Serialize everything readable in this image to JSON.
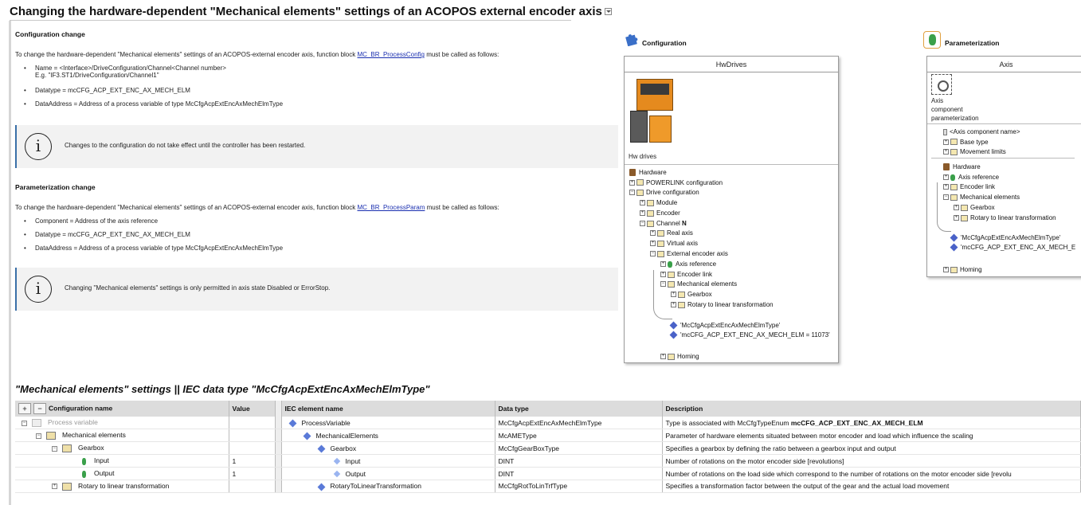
{
  "page": {
    "title": "Changing the hardware-dependent \"Mechanical elements\" settings of an ACOPOS external encoder axis"
  },
  "config_change": {
    "heading": "Configuration change",
    "intro_before": "To change the hardware-dependent \"Mechanical elements\" settings of an ACOPOS-external encoder axis, function block ",
    "link": "MC_BR_ProcessConfig",
    "intro_after": " must be called as follows:",
    "bullets": [
      "Name = <Interface>/DriveConfiguration/Channel<Channel number>",
      "Datatype = mcCFG_ACP_EXT_ENC_AX_MECH_ELM",
      "DataAddress = Address of a process variable of type McCfgAcpExtEncAxMechElmType"
    ],
    "bullet_example": "E.g. \"IF3.ST1/DriveConfiguration/Channel1\"",
    "note": "Changes to the configuration do not take effect until the controller has been restarted."
  },
  "param_change": {
    "heading": "Parameterization change",
    "intro_before": "To change the hardware-dependent \"Mechanical elements\" settings of an ACOPOS-external encoder axis, function block ",
    "link": "MC_BR_ProcessParam",
    "intro_after": " must be called as follows:",
    "bullets": [
      "Component = Address of the axis reference",
      "Datatype = mcCFG_ACP_EXT_ENC_AX_MECH_ELM",
      "DataAddress = Address of a process variable of type McCfgAcpExtEncAxMechElmType"
    ],
    "note": "Changing \"Mechanical elements\" settings is only permitted in axis state Disabled or ErrorStop."
  },
  "configuration_panel": {
    "label": "Configuration",
    "window_title": "HwDrives",
    "image_caption": "Hw drives",
    "tree": [
      "Hardware",
      "POWERLINK configuration",
      "Drive configuration",
      "Module",
      "Encoder",
      "Channel ",
      "N",
      "Real axis",
      "Virtual axis",
      "External encoder axis",
      "Axis reference",
      "Encoder link",
      "Mechanical elements",
      "Gearbox",
      "Rotary to linear transformation",
      "'McCfgAcpExtEncAxMechElmType'",
      "'mcCFG_ACP_EXT_ENC_AX_MECH_ELM = 11073'",
      "Homing"
    ]
  },
  "parameterization_panel": {
    "label": "Parameterization",
    "window_title": "Axis",
    "icon_caption": [
      "Axis",
      "component",
      "parameterization"
    ],
    "tree": [
      "<Axis component name>",
      "Base type",
      "Movement limits",
      "Hardware",
      "Axis reference",
      "Encoder link",
      "Mechanical elements",
      "Gearbox",
      "Rotary to linear transformation",
      "'McCfgAcpExtEncAxMechElmType'",
      "'mcCFG_ACP_EXT_ENC_AX_MECH_E",
      "Homing"
    ]
  },
  "table": {
    "title": "\"Mechanical elements\" settings || IEC data type \"McCfgAcpExtEncAxMechElmType\"",
    "headers": [
      "Configuration name",
      "Value",
      "IEC element name",
      "Data type",
      "Description"
    ],
    "rows": [
      {
        "config": "Process variable",
        "value": "",
        "iec": "ProcessVariable",
        "type": "McCfgAcpExtEncAxMechElmType",
        "desc": "Type is associated with McCfgTypeEnum ",
        "desc_bold": "mcCFG_ACP_EXT_ENC_AX_MECH_ELM"
      },
      {
        "config": "Mechanical elements",
        "value": "",
        "iec": "MechanicalElements",
        "type": "McAMEType",
        "desc": "Parameter of hardware elements situated between motor encoder and load which influence the scaling",
        "desc_bold": ""
      },
      {
        "config": "Gearbox",
        "value": "",
        "iec": "Gearbox",
        "type": "McCfgGearBoxType",
        "desc": "Specifies a gearbox by defining the ratio between a gearbox input and output",
        "desc_bold": ""
      },
      {
        "config": "Input",
        "value": "1",
        "iec": "Input",
        "type": "DINT",
        "desc": "Number of rotations on the motor encoder side [revolutions]",
        "desc_bold": ""
      },
      {
        "config": "Output",
        "value": "1",
        "iec": "Output",
        "type": "DINT",
        "desc": "Number of rotations on the load side which correspond to the number of rotations on the motor encoder side [revolu",
        "desc_bold": ""
      },
      {
        "config": "Rotary to linear transformation",
        "value": "",
        "iec": "RotaryToLinearTransformation",
        "type": "McCfgRotToLinTrfType",
        "desc": "Specifies a transformation factor between the output of the gear and the actual load movement",
        "desc_bold": ""
      }
    ]
  }
}
